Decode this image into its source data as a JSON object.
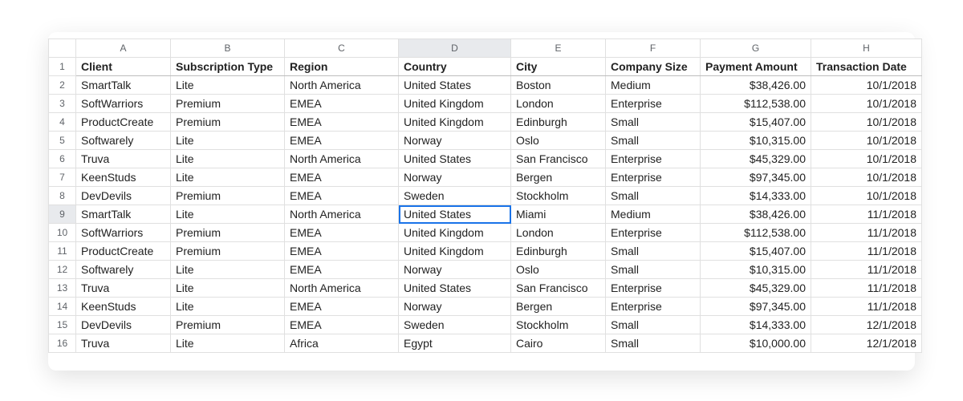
{
  "sheet": {
    "column_letters": [
      "A",
      "B",
      "C",
      "D",
      "E",
      "F",
      "G",
      "H"
    ],
    "selected_column_index": 3,
    "selected_row_number": 9,
    "selected_cell": {
      "row": 9,
      "col": 3
    },
    "header_row_number": 1,
    "headers": [
      "Client",
      "Subscription Type",
      "Region",
      "Country",
      "City",
      "Company Size",
      "Payment Amount",
      "Transaction Date"
    ],
    "right_aligned_columns": [
      6,
      7
    ],
    "rows": [
      {
        "n": 2,
        "cells": [
          "SmartTalk",
          "Lite",
          "North America",
          "United States",
          "Boston",
          "Medium",
          "$38,426.00",
          "10/1/2018"
        ]
      },
      {
        "n": 3,
        "cells": [
          "SoftWarriors",
          "Premium",
          "EMEA",
          "United Kingdom",
          "London",
          "Enterprise",
          "$112,538.00",
          "10/1/2018"
        ]
      },
      {
        "n": 4,
        "cells": [
          "ProductCreate",
          "Premium",
          "EMEA",
          "United Kingdom",
          "Edinburgh",
          "Small",
          "$15,407.00",
          "10/1/2018"
        ]
      },
      {
        "n": 5,
        "cells": [
          "Softwarely",
          "Lite",
          "EMEA",
          "Norway",
          "Oslo",
          "Small",
          "$10,315.00",
          "10/1/2018"
        ]
      },
      {
        "n": 6,
        "cells": [
          "Truva",
          "Lite",
          "North America",
          "United States",
          "San Francisco",
          "Enterprise",
          "$45,329.00",
          "10/1/2018"
        ]
      },
      {
        "n": 7,
        "cells": [
          "KeenStuds",
          "Lite",
          "EMEA",
          "Norway",
          "Bergen",
          "Enterprise",
          "$97,345.00",
          "10/1/2018"
        ]
      },
      {
        "n": 8,
        "cells": [
          "DevDevils",
          "Premium",
          "EMEA",
          "Sweden",
          "Stockholm",
          "Small",
          "$14,333.00",
          "10/1/2018"
        ]
      },
      {
        "n": 9,
        "cells": [
          "SmartTalk",
          "Lite",
          "North America",
          "United States",
          "Miami",
          "Medium",
          "$38,426.00",
          "11/1/2018"
        ]
      },
      {
        "n": 10,
        "cells": [
          "SoftWarriors",
          "Premium",
          "EMEA",
          "United Kingdom",
          "London",
          "Enterprise",
          "$112,538.00",
          "11/1/2018"
        ]
      },
      {
        "n": 11,
        "cells": [
          "ProductCreate",
          "Premium",
          "EMEA",
          "United Kingdom",
          "Edinburgh",
          "Small",
          "$15,407.00",
          "11/1/2018"
        ]
      },
      {
        "n": 12,
        "cells": [
          "Softwarely",
          "Lite",
          "EMEA",
          "Norway",
          "Oslo",
          "Small",
          "$10,315.00",
          "11/1/2018"
        ]
      },
      {
        "n": 13,
        "cells": [
          "Truva",
          "Lite",
          "North America",
          "United States",
          "San Francisco",
          "Enterprise",
          "$45,329.00",
          "11/1/2018"
        ]
      },
      {
        "n": 14,
        "cells": [
          "KeenStuds",
          "Lite",
          "EMEA",
          "Norway",
          "Bergen",
          "Enterprise",
          "$97,345.00",
          "11/1/2018"
        ]
      },
      {
        "n": 15,
        "cells": [
          "DevDevils",
          "Premium",
          "EMEA",
          "Sweden",
          "Stockholm",
          "Small",
          "$14,333.00",
          "12/1/2018"
        ]
      },
      {
        "n": 16,
        "cells": [
          "Truva",
          "Lite",
          "Africa",
          "Egypt",
          "Cairo",
          "Small",
          "$10,000.00",
          "12/1/2018"
        ]
      }
    ]
  }
}
